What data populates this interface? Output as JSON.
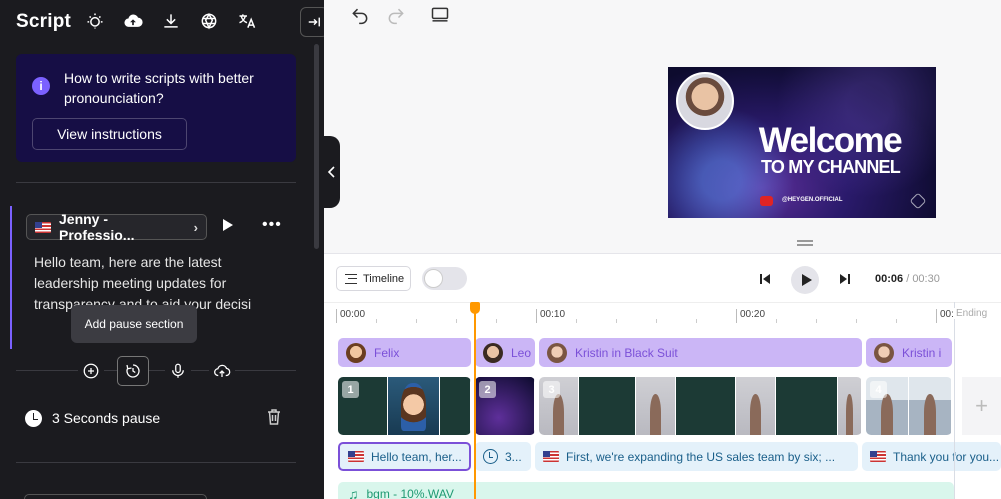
{
  "sidebar": {
    "title": "Script",
    "toolbar_icons": [
      "brightness-icon",
      "cloud-upload-icon",
      "download-icon",
      "openai-icon",
      "translate-icon"
    ],
    "help_card": {
      "text": "How to write scripts with better pronounciation?",
      "button_label": "View instructions"
    },
    "voice": {
      "name": "Jenny - Professio...",
      "flag": "us-flag"
    },
    "script_text": "Hello team, here are the latest leadership meeting updates for transparency and to aid your decisi",
    "tooltip": "Add pause section",
    "pause": {
      "label": "3  Seconds pause"
    }
  },
  "timeline": {
    "button_label": "Timeline",
    "current_time": "00:06",
    "total_time": "/ 00:30",
    "ruler_ticks": [
      "00:00",
      "00:10",
      "00:20",
      "00:"
    ],
    "ending_label": "Ending",
    "avatars": [
      {
        "name": "Felix"
      },
      {
        "name": "Leo"
      },
      {
        "name": "Kristin in Black Suit"
      },
      {
        "name": "Kristin i"
      }
    ],
    "scenes": [
      "1",
      "2",
      "3",
      "4"
    ],
    "scripts": [
      {
        "text": "Hello team, her..."
      },
      {
        "text": "3..."
      },
      {
        "text": "First, we're expanding the US sales team by six; ..."
      },
      {
        "text": "Thank you for you..."
      }
    ],
    "music": "bgm - 10%.WAV"
  },
  "preview": {
    "title": "Welcome",
    "subtitle": "TO MY CHANNEL",
    "handle": "@HEYGEN.OFFICIAL"
  },
  "colors": {
    "accent": "#7b61ff",
    "sidebar_bg": "#1b1b1f",
    "playhead": "#ff9800",
    "avatar_clip": "#cbb6f6",
    "script_clip": "#e4f1fa",
    "music_clip": "#d9f6ec"
  }
}
